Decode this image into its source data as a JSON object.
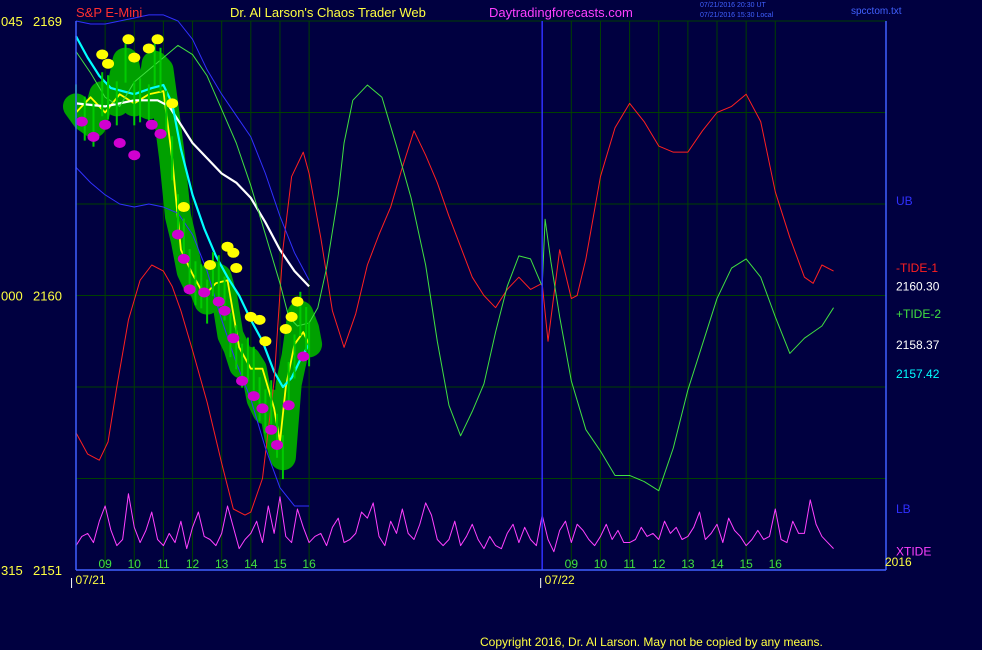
{
  "header": {
    "instrument": "S&P E-Mini",
    "author": "Dr. Al Larson's Chaos Trader Web",
    "website": "Daytradingforecasts.com",
    "timestamp_ut": "07/21/2016 20:30 UT",
    "timestamp_local": "07/21/2016 15:30 Local",
    "filename": "spcctom.txt"
  },
  "footer": {
    "copyright": "Copyright 2016, Dr. Al Larson. May not be copied by any means."
  },
  "colors": {
    "background": "#000040",
    "price_bars": "#00cc00",
    "price_halo": "#00a000",
    "fast_avg": "#ffff00",
    "slow_avg": "#ffffff",
    "ema_cyan": "#00ffff",
    "tide1": "#ff2020",
    "tide2": "#40e040",
    "xtide": "#ff40ff",
    "bands": "#3030ff",
    "grid": "#004000"
  },
  "chart_data": {
    "type": "line",
    "title": "S&P E-Mini",
    "ylim": [
      2151,
      2169
    ],
    "y_ticks": [
      {
        "value": 2169,
        "left": "045",
        "right": "2169"
      },
      {
        "value": 2160,
        "left": "000",
        "right": "2160"
      },
      {
        "value": 2151,
        "left": "315",
        "right": "2151"
      }
    ],
    "xlim": [
      8.0,
      35.8
    ],
    "x_ticks": [
      {
        "x": 9,
        "label": "09"
      },
      {
        "x": 10,
        "label": "10"
      },
      {
        "x": 11,
        "label": "11"
      },
      {
        "x": 12,
        "label": "12"
      },
      {
        "x": 13,
        "label": "13"
      },
      {
        "x": 14,
        "label": "14"
      },
      {
        "x": 15,
        "label": "15"
      },
      {
        "x": 16,
        "label": "16"
      },
      {
        "x": 25,
        "label": "09"
      },
      {
        "x": 26,
        "label": "10"
      },
      {
        "x": 27,
        "label": "11"
      },
      {
        "x": 28,
        "label": "12"
      },
      {
        "x": 29,
        "label": "13"
      },
      {
        "x": 30,
        "label": "14"
      },
      {
        "x": 31,
        "label": "15"
      },
      {
        "x": 32,
        "label": "16"
      }
    ],
    "date_labels": [
      {
        "x": 8.5,
        "label": "07/21"
      },
      {
        "x": 24.6,
        "label": "07/22"
      }
    ],
    "year_label": "2016",
    "day_divider_x": 24.0,
    "right_labels": [
      {
        "text": "UB",
        "value": 2163.1,
        "color": "#3030ff"
      },
      {
        "text": "-TIDE-1",
        "value": 2160.9,
        "color": "#ff2020"
      },
      {
        "text": "2160.30",
        "value": 2160.3,
        "color": "#ffffff"
      },
      {
        "text": "+TIDE-2",
        "value": 2159.4,
        "color": "#40e040"
      },
      {
        "text": "2158.37",
        "value": 2158.37,
        "color": "#ffffff"
      },
      {
        "text": "2157.42",
        "value": 2157.42,
        "color": "#00ffff"
      },
      {
        "text": "LB",
        "value": 2153.0,
        "color": "#3030ff"
      },
      {
        "text": "XTIDE",
        "value": 2151.6,
        "color": "#ff40ff"
      }
    ],
    "series": [
      {
        "name": "price",
        "kind": "bars",
        "color": "#00cc00",
        "x": [
          8.0,
          8.3,
          8.6,
          8.9,
          9.1,
          9.4,
          9.7,
          10.0,
          10.2,
          10.5,
          10.7,
          10.9,
          11.1,
          11.3,
          11.5,
          11.7,
          11.9,
          12.1,
          12.3,
          12.5,
          12.7,
          12.9,
          13.1,
          13.3,
          13.5,
          13.7,
          13.9,
          14.1,
          14.3,
          14.5,
          14.7,
          14.9,
          15.1,
          15.3,
          15.5,
          15.7,
          15.9,
          16.0
        ],
        "y": [
          2166.2,
          2165.8,
          2165.6,
          2166.6,
          2166.5,
          2166.3,
          2167.7,
          2166.3,
          2166.4,
          2166.2,
          2167.6,
          2167.4,
          2166.0,
          2164.5,
          2162.6,
          2161.8,
          2160.8,
          2160.4,
          2160.3,
          2159.8,
          2160.7,
          2160.6,
          2159.9,
          2158.7,
          2158.3,
          2157.7,
          2157.9,
          2157.6,
          2156.6,
          2156.2,
          2156.5,
          2155.4,
          2154.7,
          2157.1,
          2158.0,
          2159.4,
          2158.9,
          2158.4
        ]
      },
      {
        "name": "fast",
        "color": "#ffff00",
        "x": [
          8.0,
          8.5,
          9.0,
          9.5,
          10.0,
          10.5,
          11.0,
          11.3,
          11.6,
          12.0,
          12.4,
          12.8,
          13.2,
          13.6,
          14.0,
          14.4,
          14.8,
          15.0,
          15.2,
          15.5,
          15.8,
          16.0
        ],
        "y": [
          2166.0,
          2166.5,
          2166.0,
          2166.6,
          2166.3,
          2166.6,
          2166.7,
          2164.5,
          2161.5,
          2160.7,
          2160.0,
          2160.4,
          2160.5,
          2158.3,
          2157.6,
          2157.6,
          2156.3,
          2155.2,
          2157.0,
          2158.4,
          2158.8,
          2158.4
        ]
      },
      {
        "name": "slow",
        "color": "#ffffff",
        "x": [
          8.0,
          9.0,
          10.0,
          10.8,
          11.2,
          11.6,
          12.0,
          12.5,
          13.0,
          13.5,
          14.0,
          14.5,
          15.0,
          15.5,
          16.0
        ],
        "y": [
          2166.3,
          2166.2,
          2166.4,
          2166.4,
          2166.2,
          2165.6,
          2165.0,
          2164.5,
          2164.0,
          2163.7,
          2163.2,
          2162.4,
          2161.5,
          2160.8,
          2160.3
        ]
      },
      {
        "name": "ema",
        "color": "#00ffff",
        "x": [
          8.0,
          8.4,
          8.8,
          9.2,
          10.0,
          10.6,
          11.0,
          11.3,
          11.6,
          12.0,
          12.4,
          12.8,
          13.2,
          13.6,
          14.0,
          14.4,
          14.8,
          15.1,
          15.4,
          15.7,
          16.0
        ],
        "y": [
          2168.5,
          2167.8,
          2167.2,
          2166.8,
          2166.6,
          2166.8,
          2166.9,
          2166.3,
          2164.8,
          2163.3,
          2162.2,
          2161.3,
          2160.6,
          2160.0,
          2159.2,
          2158.5,
          2157.5,
          2157.0,
          2157.3,
          2157.9,
          2158.4
        ]
      },
      {
        "name": "TIDE-1",
        "color": "#ff2020",
        "x": [
          8.0,
          8.4,
          8.8,
          9.1,
          9.4,
          9.8,
          10.2,
          10.6,
          11.0,
          11.3,
          11.6,
          12.0,
          12.5,
          13.0,
          13.4,
          13.8,
          14.0,
          14.4,
          14.8,
          15.1,
          15.4,
          15.8,
          16.0,
          16.4,
          16.8,
          17.2,
          17.6,
          18.0,
          18.4,
          18.8,
          19.2,
          19.6,
          20.0,
          20.4,
          20.8,
          21.2,
          21.6,
          22.0,
          22.4,
          22.8,
          23.2,
          23.6,
          24.0,
          24.2,
          24.6,
          25.0,
          25.2,
          25.5,
          26.0,
          26.5,
          27.0,
          27.5,
          28.0,
          28.5,
          29.0,
          29.5,
          30.0,
          30.5,
          31.0,
          31.5,
          32.0,
          32.5,
          33.0,
          33.3,
          33.6,
          34.0
        ],
        "y": [
          2155.5,
          2154.8,
          2154.6,
          2155.2,
          2157.0,
          2159.2,
          2160.5,
          2161.0,
          2160.8,
          2160.3,
          2159.5,
          2158.2,
          2156.5,
          2154.5,
          2153.0,
          2152.8,
          2152.9,
          2154.0,
          2157.2,
          2161.5,
          2163.9,
          2164.7,
          2164.0,
          2161.9,
          2159.5,
          2158.3,
          2159.4,
          2161.0,
          2162.0,
          2162.9,
          2164.2,
          2165.4,
          2164.6,
          2163.7,
          2162.6,
          2161.6,
          2160.6,
          2160.0,
          2159.6,
          2160.2,
          2160.6,
          2160.2,
          2160.4,
          2158.5,
          2161.5,
          2159.9,
          2160.0,
          2161.2,
          2163.9,
          2165.5,
          2166.3,
          2165.7,
          2164.9,
          2164.7,
          2164.7,
          2165.4,
          2166.0,
          2166.2,
          2166.6,
          2165.7,
          2163.4,
          2161.9,
          2160.6,
          2160.4,
          2161.0,
          2160.8
        ]
      },
      {
        "name": "TIDE-2",
        "color": "#40e040",
        "x": [
          8.0,
          8.5,
          9.0,
          9.5,
          10.0,
          10.5,
          11.0,
          11.5,
          12.0,
          12.5,
          13.0,
          13.5,
          14.0,
          14.5,
          15.0,
          15.3,
          15.6,
          16.0,
          16.3,
          16.6,
          17.0,
          17.2,
          17.5,
          18.0,
          18.5,
          19.0,
          19.5,
          20.0,
          20.4,
          20.8,
          21.2,
          21.6,
          22.0,
          22.4,
          22.8,
          23.2,
          23.6,
          24.0,
          24.1,
          24.3,
          24.6,
          25.0,
          25.5,
          26.0,
          26.5,
          27.0,
          27.5,
          28.0,
          28.5,
          29.0,
          29.5,
          30.0,
          30.5,
          31.0,
          31.5,
          32.0,
          32.5,
          33.0,
          33.3,
          33.6,
          34.0
        ],
        "y": [
          2168.0,
          2167.3,
          2166.5,
          2166.2,
          2167.0,
          2167.4,
          2167.8,
          2168.2,
          2167.9,
          2167.2,
          2166.1,
          2165.0,
          2163.6,
          2162.0,
          2160.4,
          2159.3,
          2159.0,
          2159.1,
          2159.6,
          2160.9,
          2163.3,
          2165.0,
          2166.4,
          2166.9,
          2166.5,
          2164.9,
          2163.2,
          2161.0,
          2158.5,
          2156.4,
          2155.4,
          2156.2,
          2157.1,
          2158.8,
          2160.3,
          2161.3,
          2161.2,
          2160.3,
          2162.5,
          2161.1,
          2159.3,
          2157.2,
          2155.6,
          2154.9,
          2154.1,
          2154.1,
          2153.9,
          2153.6,
          2155.0,
          2156.9,
          2158.4,
          2159.9,
          2160.9,
          2161.2,
          2160.6,
          2159.3,
          2158.1,
          2158.6,
          2158.8,
          2159.0,
          2159.6
        ]
      },
      {
        "name": "UB",
        "color": "#3030ff",
        "x": [
          8.0,
          8.5,
          9.0,
          9.5,
          10.0,
          10.5,
          11.0,
          11.5,
          12.0,
          12.5,
          13.0,
          13.5,
          14.0,
          14.5,
          15.0,
          15.5,
          16.0
        ],
        "y": [
          2169.0,
          2168.9,
          2168.9,
          2169.0,
          2169.1,
          2169.2,
          2169.2,
          2169.0,
          2168.4,
          2167.4,
          2166.6,
          2165.9,
          2165.2,
          2164.0,
          2162.6,
          2161.4,
          2160.5
        ]
      },
      {
        "name": "LB",
        "color": "#3030ff",
        "x": [
          8.0,
          8.5,
          9.0,
          9.5,
          10.0,
          10.5,
          11.0,
          11.5,
          12.0,
          12.5,
          13.0,
          13.5,
          14.0,
          14.5,
          15.0,
          15.5,
          16.0
        ],
        "y": [
          2164.2,
          2163.7,
          2163.3,
          2163.0,
          2162.9,
          2163.0,
          2162.9,
          2162.7,
          2162.0,
          2160.8,
          2159.2,
          2157.8,
          2156.6,
          2155.0,
          2153.7,
          2153.1,
          2153.1
        ]
      },
      {
        "name": "XTIDE",
        "color": "#ff40ff",
        "x": [
          8.0,
          8.2,
          8.4,
          8.6,
          8.8,
          9.0,
          9.2,
          9.4,
          9.6,
          9.8,
          10.0,
          10.2,
          10.4,
          10.6,
          10.8,
          11.0,
          11.2,
          11.4,
          11.6,
          11.8,
          12.0,
          12.2,
          12.4,
          12.6,
          12.8,
          13.0,
          13.2,
          13.4,
          13.6,
          13.8,
          14.0,
          14.2,
          14.4,
          14.6,
          14.8,
          15.0,
          15.2,
          15.4,
          15.6,
          15.8,
          16.0,
          16.2,
          16.4,
          16.6,
          16.8,
          17.0,
          17.2,
          17.4,
          17.6,
          17.8,
          18.0,
          18.2,
          18.4,
          18.6,
          18.8,
          19.0,
          19.2,
          19.4,
          19.6,
          19.8,
          20.0,
          20.2,
          20.4,
          20.6,
          20.8,
          21.0,
          21.2,
          21.4,
          21.6,
          21.8,
          22.0,
          22.2,
          22.4,
          22.6,
          22.8,
          23.0,
          23.2,
          23.4,
          23.6,
          23.8,
          24.0,
          24.2,
          24.4,
          24.6,
          24.8,
          25.0,
          25.2,
          25.4,
          25.6,
          25.8,
          26.0,
          26.2,
          26.4,
          26.6,
          26.8,
          27.0,
          27.2,
          27.4,
          27.6,
          27.8,
          28.0,
          28.2,
          28.4,
          28.6,
          28.8,
          29.0,
          29.2,
          29.4,
          29.6,
          29.8,
          30.0,
          30.2,
          30.4,
          30.6,
          30.8,
          31.0,
          31.2,
          31.4,
          31.6,
          31.8,
          32.0,
          32.2,
          32.4,
          32.6,
          32.8,
          33.0,
          33.2,
          33.4,
          33.6,
          33.8,
          34.0
        ],
        "y": [
          2151.8,
          2152.1,
          2152.2,
          2151.9,
          2152.6,
          2153.1,
          2152.3,
          2151.8,
          2152.0,
          2153.5,
          2152.4,
          2151.9,
          2152.3,
          2152.9,
          2152.0,
          2151.8,
          2152.2,
          2151.9,
          2152.6,
          2151.7,
          2152.4,
          2152.9,
          2152.1,
          2152.0,
          2151.8,
          2152.2,
          2153.1,
          2152.4,
          2151.7,
          2152.0,
          2152.2,
          2152.6,
          2151.9,
          2153.1,
          2152.2,
          2153.4,
          2152.1,
          2151.9,
          2153.0,
          2152.4,
          2151.9,
          2152.1,
          2152.2,
          2151.8,
          2152.4,
          2152.7,
          2151.9,
          2152.0,
          2152.2,
          2152.9,
          2152.7,
          2153.2,
          2152.1,
          2151.8,
          2152.6,
          2152.2,
          2153.0,
          2152.2,
          2152.0,
          2152.5,
          2153.2,
          2152.8,
          2152.0,
          2151.8,
          2152.0,
          2152.6,
          2151.8,
          2152.1,
          2152.5,
          2152.0,
          2151.7,
          2152.1,
          2151.8,
          2151.7,
          2152.2,
          2152.5,
          2151.9,
          2152.4,
          2152.0,
          2151.8,
          2152.8,
          2152.0,
          2151.6,
          2152.3,
          2152.6,
          2151.9,
          2152.5,
          2152.3,
          2152.0,
          2151.8,
          2152.1,
          2152.5,
          2152.0,
          2152.3,
          2151.9,
          2151.9,
          2152.0,
          2152.4,
          2152.1,
          2152.2,
          2152.0,
          2152.6,
          2152.2,
          2152.4,
          2152.0,
          2152.1,
          2152.4,
          2152.9,
          2152.0,
          2152.2,
          2152.5,
          2151.9,
          2152.7,
          2152.3,
          2152.1,
          2151.8,
          2152.0,
          2152.3,
          2152.0,
          2152.1,
          2153.0,
          2152.0,
          2151.9,
          2152.6,
          2152.2,
          2152.2,
          2153.3,
          2152.5,
          2152.1,
          2151.9,
          2151.7
        ]
      }
    ],
    "markers": {
      "yellow": [
        [
          8.9,
          2167.9
        ],
        [
          9.1,
          2167.6
        ],
        [
          9.8,
          2168.4
        ],
        [
          10.0,
          2167.8
        ],
        [
          10.5,
          2168.1
        ],
        [
          10.8,
          2168.4
        ],
        [
          11.3,
          2166.3
        ],
        [
          11.7,
          2162.9
        ],
        [
          12.6,
          2161.0
        ],
        [
          13.2,
          2161.6
        ],
        [
          13.4,
          2161.4
        ],
        [
          13.5,
          2160.9
        ],
        [
          14.0,
          2159.3
        ],
        [
          14.3,
          2159.2
        ],
        [
          14.5,
          2158.5
        ],
        [
          15.2,
          2158.9
        ],
        [
          15.4,
          2159.3
        ],
        [
          15.6,
          2159.8
        ]
      ],
      "magenta": [
        [
          8.2,
          2165.7
        ],
        [
          8.6,
          2165.2
        ],
        [
          9.0,
          2165.6
        ],
        [
          9.5,
          2165.0
        ],
        [
          10.0,
          2164.6
        ],
        [
          10.6,
          2165.6
        ],
        [
          10.9,
          2165.3
        ],
        [
          11.5,
          2162.0
        ],
        [
          11.7,
          2161.2
        ],
        [
          11.9,
          2160.2
        ],
        [
          12.4,
          2160.1
        ],
        [
          12.9,
          2159.8
        ],
        [
          13.1,
          2159.5
        ],
        [
          13.4,
          2158.6
        ],
        [
          13.7,
          2157.2
        ],
        [
          14.1,
          2156.7
        ],
        [
          14.4,
          2156.3
        ],
        [
          14.7,
          2155.6
        ],
        [
          14.9,
          2155.1
        ],
        [
          15.3,
          2156.4
        ],
        [
          15.8,
          2158.0
        ]
      ]
    }
  }
}
